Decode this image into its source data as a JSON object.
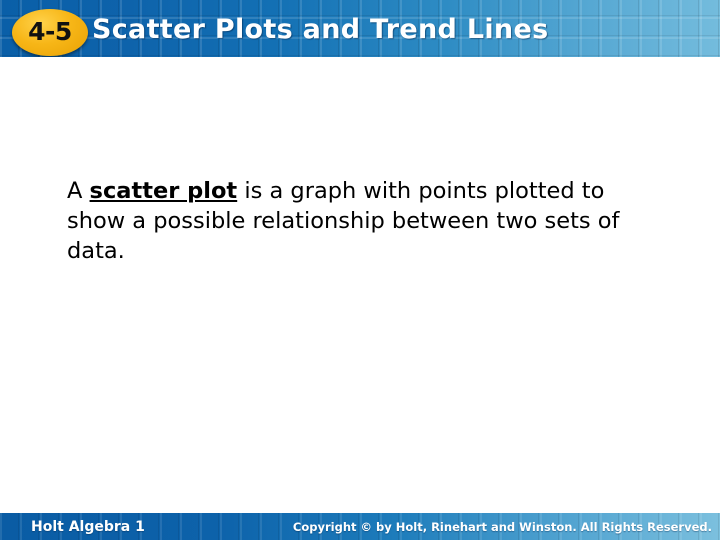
{
  "slide": {
    "header": {
      "lesson_number": "4-5",
      "title": "Scatter Plots and Trend Lines",
      "bg_color_left": "#0a5fa8",
      "bg_color_right": "#74bcdd",
      "badge_color": "#f7b617",
      "title_color": "#ffffff"
    },
    "body": {
      "paragraph_part1": "A ",
      "paragraph_term": "scatter plot",
      "paragraph_part2": " is a graph with points plotted to show a possible relationship between two sets of data.",
      "text_color": "#000000",
      "background": "#ffffff"
    },
    "footer": {
      "book_title": "Holt Algebra 1",
      "copyright": "Copyright © by Holt, Rinehart and Winston. All Rights Reserved.",
      "bg_color_left": "#0a5ca4",
      "bg_color_right": "#7cc0de",
      "text_color": "#ffffff"
    }
  }
}
